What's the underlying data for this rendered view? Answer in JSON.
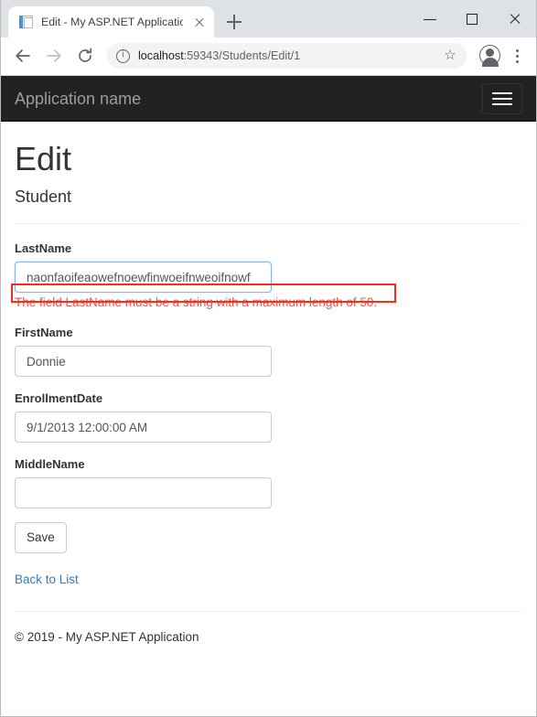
{
  "browser": {
    "tab": {
      "title": "Edit - My ASP.NET Application",
      "favicon": "page-icon",
      "close_icon": "close-icon"
    },
    "new_tab_icon": "plus-icon",
    "window_controls": {
      "minimize": "minimize-icon",
      "maximize": "maximize-icon",
      "close": "close-icon"
    },
    "nav": {
      "back_icon": "arrow-left-icon",
      "forward_icon": "arrow-right-icon",
      "reload_icon": "reload-icon"
    },
    "omnibox": {
      "security_icon": "info-circle-icon",
      "url_host": "localhost",
      "url_path": ":59343/Students/Edit/1",
      "bookmark_icon": "star-icon"
    },
    "profile_icon": "account-circle-icon",
    "menu_icon": "kebab-menu-icon"
  },
  "page": {
    "navbar": {
      "brand": "Application name",
      "toggle_icon": "hamburger-icon"
    },
    "title": "Edit",
    "subtitle": "Student",
    "form": {
      "fields": [
        {
          "label": "LastName",
          "value": "naonfaoifeaowefnoewfinwoeifnweoifnowf",
          "placeholder": "",
          "error": "The field LastName must be a string with a maximum length of 50.",
          "highlighted": true
        },
        {
          "label": "FirstName",
          "value": "Donnie",
          "placeholder": "",
          "error": "",
          "highlighted": false
        },
        {
          "label": "EnrollmentDate",
          "value": "9/1/2013 12:00:00 AM",
          "placeholder": "",
          "error": "",
          "highlighted": false
        },
        {
          "label": "MiddleName",
          "value": "",
          "placeholder": "",
          "error": "",
          "highlighted": false
        }
      ],
      "submit_label": "Save"
    },
    "back_link": "Back to List",
    "footer": "© 2019 - My ASP.NET Application"
  },
  "colors": {
    "navbar_bg": "#222222",
    "brand_text": "#9d9d9d",
    "error_text": "#e8584b",
    "annotation_border": "#fb2b1e",
    "link": "#337ab7",
    "input_border": "#cccccc",
    "focus_border": "#8ab4e8"
  }
}
